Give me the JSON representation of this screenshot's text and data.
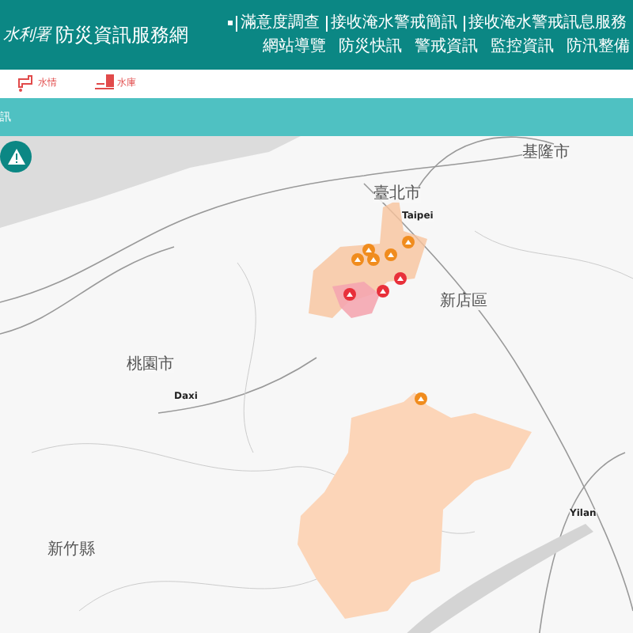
{
  "header": {
    "logo": "水利署",
    "title": "防災資訊服務網",
    "top_links": [
      "滿意度調查",
      "接收淹水警戒簡訊",
      "接收淹水警戒訊息服務"
    ],
    "nav": [
      "網站導覽",
      "防災快訊",
      "警戒資訊",
      "監控資訊",
      "防汛整備"
    ]
  },
  "subnav": [
    {
      "label": "水情",
      "kind": "faucet"
    },
    {
      "label": "水庫",
      "kind": "dam"
    }
  ],
  "section_bar": {
    "title": "訊"
  },
  "map": {
    "labels": [
      {
        "text": "臺北市",
        "kind": "small"
      },
      {
        "text": "Taipei",
        "kind": "city"
      },
      {
        "text": "基隆市",
        "kind": "small"
      },
      {
        "text": "新店區",
        "kind": "small"
      },
      {
        "text": "桃園市",
        "kind": "small"
      },
      {
        "text": "Daxi",
        "kind": "city"
      },
      {
        "text": "Yilan",
        "kind": "city"
      },
      {
        "text": "新竹縣",
        "kind": "small"
      }
    ],
    "markers": [
      {
        "color": "#f08c1e"
      },
      {
        "color": "#f08c1e"
      },
      {
        "color": "#f08c1e"
      },
      {
        "color": "#f08c1e"
      },
      {
        "color": "#f08c1e"
      },
      {
        "color": "#e8303a"
      },
      {
        "color": "#e8303a"
      },
      {
        "color": "#e8303a"
      },
      {
        "color": "#f08c1e"
      }
    ]
  }
}
